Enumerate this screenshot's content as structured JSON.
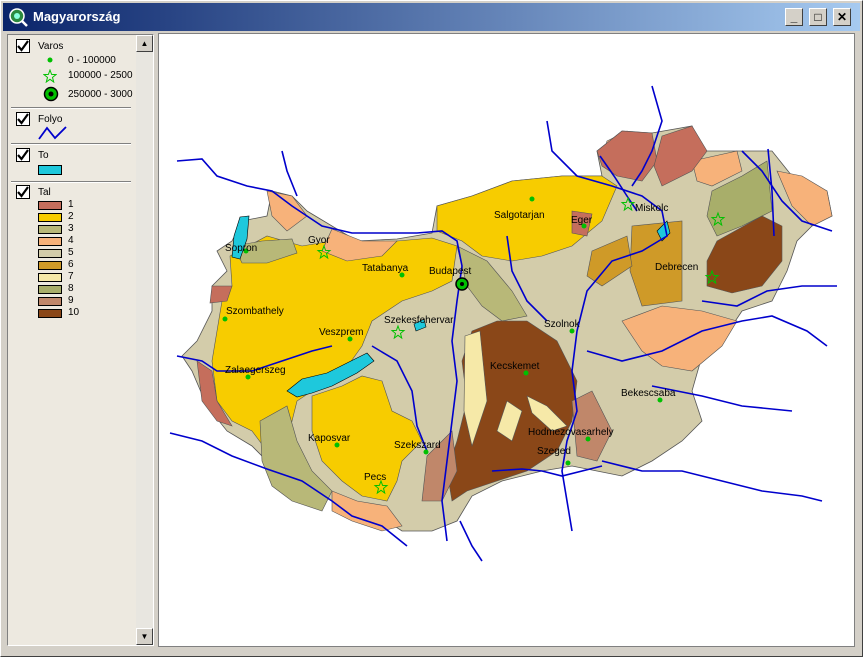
{
  "window": {
    "title": "Magyarország",
    "minimize": "_",
    "maximize": "□",
    "close": "✕"
  },
  "toc": {
    "layers": [
      {
        "name": "Varos",
        "items": [
          "0 - 100000",
          "100000 - 2500",
          "250000 - 3000"
        ]
      },
      {
        "name": "Folyo"
      },
      {
        "name": "To"
      },
      {
        "name": "Tal",
        "classes": [
          "1",
          "2",
          "3",
          "4",
          "5",
          "6",
          "7",
          "8",
          "9",
          "10"
        ]
      }
    ],
    "tal_colors": [
      "#c56e5c",
      "#f7cc00",
      "#b8b878",
      "#f7b27a",
      "#d3ccaa",
      "#cf9a28",
      "#f6e9a8",
      "#a8ae6a",
      "#c0876a",
      "#8a4718"
    ]
  },
  "cities": [
    {
      "name": "Sopron"
    },
    {
      "name": "Gyor"
    },
    {
      "name": "Tatabanya"
    },
    {
      "name": "Budapest"
    },
    {
      "name": "Salgotarjan"
    },
    {
      "name": "Eger"
    },
    {
      "name": "Miskolc"
    },
    {
      "name": "Debrecen"
    },
    {
      "name": "Szombathely"
    },
    {
      "name": "Veszprem"
    },
    {
      "name": "Szekesfehervar"
    },
    {
      "name": "Szolnok"
    },
    {
      "name": "Zalaegerszeg"
    },
    {
      "name": "Kecskemet"
    },
    {
      "name": "Bekescsaba"
    },
    {
      "name": "Kaposvar"
    },
    {
      "name": "Szekszard"
    },
    {
      "name": "Hodmezovasarhely"
    },
    {
      "name": "Szeged"
    },
    {
      "name": "Pecs"
    }
  ],
  "colors": {
    "river": "#0000cc",
    "lake": "#1ec8dc",
    "city_dot": "#00c000",
    "title_bar": "#0a246a"
  }
}
